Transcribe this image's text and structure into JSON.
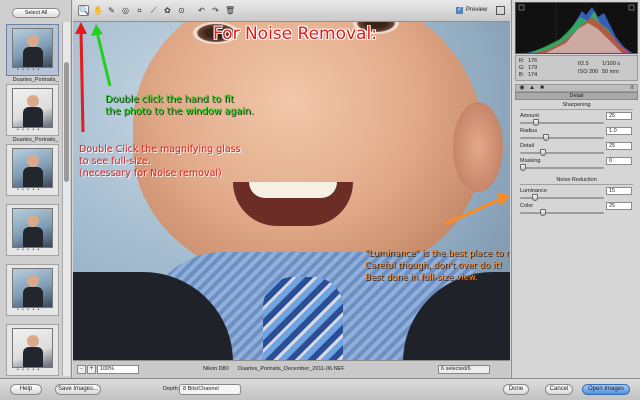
{
  "filmstrip": {
    "select_all_label": "Select All",
    "thumbnails": [
      {
        "label": "Duartes_Portraits_",
        "style": "blue",
        "selected": true
      },
      {
        "label": "Duartes_Portraits_",
        "style": "white",
        "selected": false
      },
      {
        "label": "",
        "style": "blue",
        "selected": false
      },
      {
        "label": "",
        "style": "blue",
        "selected": false
      },
      {
        "label": "",
        "style": "blue",
        "selected": false
      },
      {
        "label": "",
        "style": "white",
        "selected": false
      }
    ],
    "thumb_dots": "• • • • •"
  },
  "toolbar": {
    "tools": [
      {
        "name": "zoom-tool-icon",
        "glyph": "🔍",
        "active": true
      },
      {
        "name": "hand-tool-icon",
        "glyph": "✋",
        "active": false
      },
      {
        "name": "eyedropper-icon",
        "glyph": "✎",
        "active": false
      },
      {
        "name": "white-balance-icon",
        "glyph": "◎",
        "active": false
      },
      {
        "name": "crop-icon",
        "glyph": "⌗",
        "active": false
      },
      {
        "name": "straighten-icon",
        "glyph": "⟋",
        "active": false
      },
      {
        "name": "retouch-icon",
        "glyph": "✿",
        "active": false
      },
      {
        "name": "redeye-icon",
        "glyph": "⊙",
        "active": false
      },
      {
        "name": "rotate-left-icon",
        "glyph": "↶",
        "active": false
      },
      {
        "name": "rotate-right-icon",
        "glyph": "↷",
        "active": false
      },
      {
        "name": "trash-icon",
        "glyph": "🗑",
        "active": false
      }
    ],
    "preview_label": "Preview",
    "preview_checked": true
  },
  "annotations": {
    "title": "For Noise Removal:",
    "hand_lines": [
      "Double click the hand to fit",
      "the photo to the window again."
    ],
    "glass_lines": [
      "Double Click the magnifying glass",
      "to see full-size.",
      "(necessary for Noise removal)"
    ],
    "luminance_lines": [
      "\"Luminance\" is the best place to reduce noise.",
      "Careful though, don't over do it!",
      "Best done in full-size view."
    ],
    "colors": {
      "title": "#e21b1b",
      "hand": "#23d11d",
      "glass": "#e21b1b",
      "luminance": "#ff8a1f"
    }
  },
  "status": {
    "zoom_minus": "-",
    "zoom_plus": "+",
    "zoom_value": "100%",
    "camera": "Nikon D80",
    "filename": "Duartes_Portraits_December_2011-06.NEF",
    "selected_count": "6 selected/6"
  },
  "readout": {
    "r_label": "R:",
    "r_value": "176",
    "g_label": "G:",
    "g_value": "179",
    "b_label": "B:",
    "b_value": "174",
    "aperture": "f/2.5",
    "shutter": "1/100 s",
    "iso": "ISO 200",
    "focal": "50 mm"
  },
  "panel": {
    "header": "Detail",
    "sharpening_title": "Sharpening",
    "noise_title": "Noise Reduction",
    "sharpening": [
      {
        "key": "amount",
        "label": "Amount",
        "value": "25",
        "fraction": 0.17
      },
      {
        "key": "radius",
        "label": "Radius",
        "value": "1.0",
        "fraction": 0.3
      },
      {
        "key": "detail",
        "label": "Detail",
        "value": "25",
        "fraction": 0.25
      },
      {
        "key": "masking",
        "label": "Masking",
        "value": "0",
        "fraction": 0.0
      }
    ],
    "noise": [
      {
        "key": "luminance",
        "label": "Luminance",
        "value": "15",
        "fraction": 0.15
      },
      {
        "key": "color",
        "label": "Color",
        "value": "25",
        "fraction": 0.25
      }
    ]
  },
  "bottom": {
    "help_label": "Help",
    "save_label": "Save Images...",
    "depth_label": "Depth:",
    "depth_value": "8 Bits/Channel",
    "done_label": "Done",
    "cancel_label": "Cancel",
    "open_label": "Open Images"
  }
}
